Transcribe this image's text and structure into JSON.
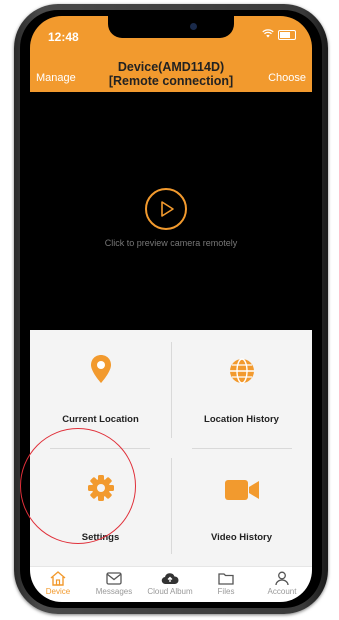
{
  "status_bar": {
    "time": "12:48"
  },
  "header": {
    "title_line1": "Device(AMD114D)",
    "title_line2": "[Remote connection]",
    "left_button": "Manage",
    "right_button": "Choose"
  },
  "preview": {
    "text": "Click to preview camera remotely"
  },
  "grid": {
    "items": [
      {
        "label": "Current Location",
        "icon": "location-pin-icon"
      },
      {
        "label": "Location History",
        "icon": "globe-icon"
      },
      {
        "label": "Settings",
        "icon": "gear-icon"
      },
      {
        "label": "Video History",
        "icon": "video-camera-icon"
      }
    ]
  },
  "tabs": [
    {
      "label": "Device",
      "icon": "home-icon",
      "active": true
    },
    {
      "label": "Messages",
      "icon": "envelope-icon",
      "active": false
    },
    {
      "label": "Cloud Album",
      "icon": "cloud-icon",
      "active": false
    },
    {
      "label": "Files",
      "icon": "folder-icon",
      "active": false
    },
    {
      "label": "Account",
      "icon": "person-icon",
      "active": false
    }
  ],
  "colors": {
    "accent": "#f29a2e",
    "highlight": "#e0303a"
  }
}
